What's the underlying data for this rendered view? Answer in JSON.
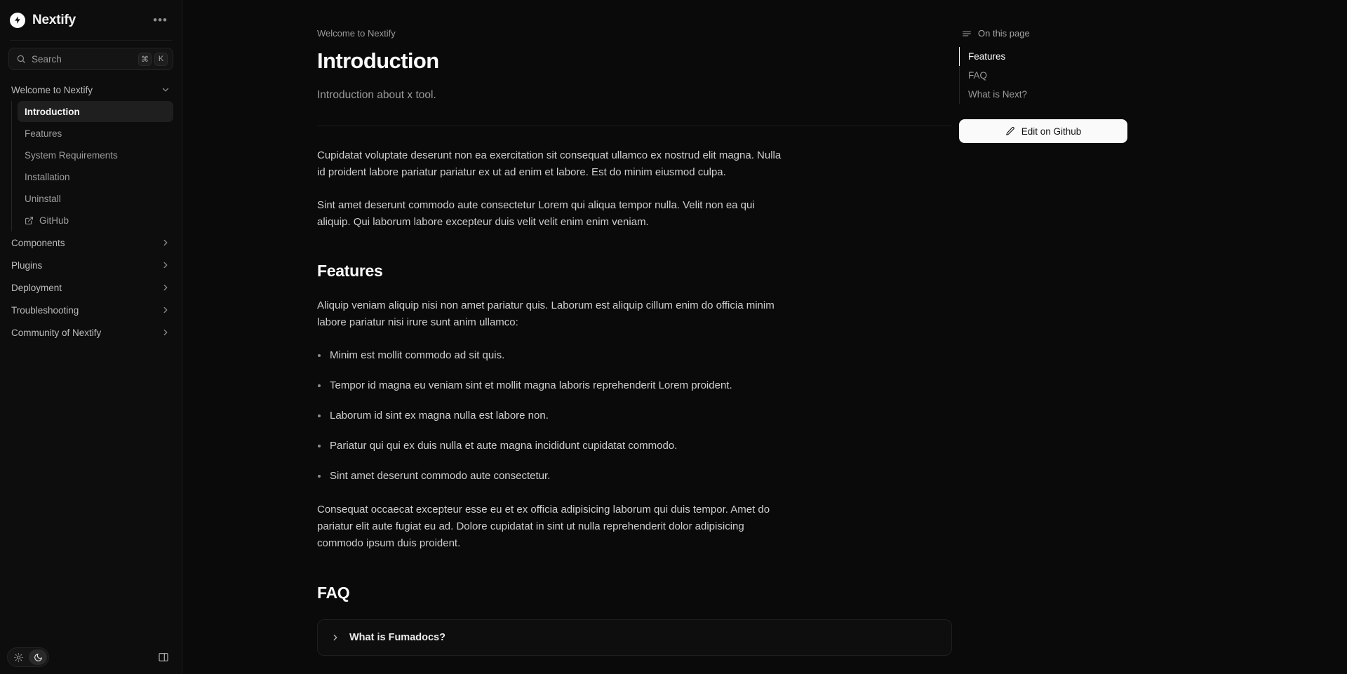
{
  "brand": {
    "name": "Nextify",
    "logo_icon": "lightning-bolt-icon",
    "more_label": "•••"
  },
  "search": {
    "placeholder": "Search",
    "shortcut_keys": [
      "⌘",
      "K"
    ],
    "icon": "search-icon"
  },
  "sidebar": {
    "group": {
      "label": "Welcome to Nextify",
      "expanded": true,
      "items": [
        {
          "label": "Introduction",
          "active": true,
          "icon": null
        },
        {
          "label": "Features",
          "active": false,
          "icon": null
        },
        {
          "label": "System Requirements",
          "active": false,
          "icon": null
        },
        {
          "label": "Installation",
          "active": false,
          "icon": null
        },
        {
          "label": "Uninstall",
          "active": false,
          "icon": null
        },
        {
          "label": "GitHub",
          "active": false,
          "icon": "external-link-icon"
        }
      ]
    },
    "sections": [
      {
        "label": "Components",
        "icon": "chevron-right-icon"
      },
      {
        "label": "Plugins",
        "icon": "chevron-right-icon"
      },
      {
        "label": "Deployment",
        "icon": "chevron-right-icon"
      },
      {
        "label": "Troubleshooting",
        "icon": "chevron-right-icon"
      },
      {
        "label": "Community of Nextify",
        "icon": "chevron-right-icon"
      }
    ],
    "footer": {
      "light_icon": "sun-icon",
      "dark_icon": "moon-icon",
      "active_theme": "dark",
      "collapse_icon": "sidebar-collapse-icon"
    }
  },
  "content": {
    "breadcrumb": "Welcome to Nextify",
    "title": "Introduction",
    "description": "Introduction about x tool.",
    "paragraphs": [
      "Cupidatat voluptate deserunt non ea exercitation sit consequat ullamco ex nostrud elit magna. Nulla id proident labore pariatur pariatur ex ut ad enim et labore. Est do minim eiusmod culpa.",
      "Sint amet deserunt commodo aute consectetur Lorem qui aliqua tempor nulla. Velit non ea qui aliquip. Qui laborum labore excepteur duis velit velit enim enim veniam."
    ],
    "features": {
      "heading": "Features",
      "intro": "Aliquip veniam aliquip nisi non amet pariatur quis. Laborum est aliquip cillum enim do officia minim labore pariatur nisi irure sunt anim ullamco:",
      "items": [
        "Minim est mollit commodo ad sit quis.",
        "Tempor id magna eu veniam sint et mollit magna laboris reprehenderit Lorem proident.",
        "Laborum id sint ex magna nulla est labore non.",
        "Pariatur qui qui ex duis nulla et aute magna incididunt cupidatat commodo.",
        "Sint amet deserunt commodo aute consectetur."
      ],
      "outro": "Consequat occaecat excepteur esse eu et ex officia adipisicing laborum qui duis tempor. Amet do pariatur elit aute fugiat eu ad. Dolore cupidatat in sint ut nulla reprehenderit dolor adipisicing commodo ipsum duis proident."
    },
    "faq": {
      "heading": "FAQ",
      "items": [
        {
          "question": "What is Fumadocs?",
          "expanded": false,
          "icon": "chevron-right-icon"
        }
      ]
    }
  },
  "toc": {
    "heading": "On this page",
    "heading_icon": "menu-icon",
    "items": [
      {
        "label": "Features",
        "active": true
      },
      {
        "label": "FAQ",
        "active": false
      },
      {
        "label": "What is Next?",
        "active": false
      }
    ],
    "edit_button": {
      "label": "Edit on Github",
      "icon": "pencil-edit-icon"
    }
  },
  "colors": {
    "page_bg": "#0a0a0a",
    "sidebar_bg": "#0d0d0d",
    "border": "#1c1c1c",
    "text_primary": "#fbfbfb",
    "text_muted": "#9a9a9a",
    "accent_button_bg": "#fafafa"
  }
}
